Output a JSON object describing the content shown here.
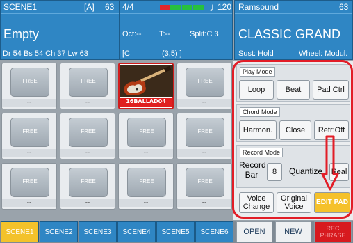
{
  "header": {
    "scene_name": "SCENE1",
    "scene_bank": "[A]",
    "scene_num": "63",
    "scene_title": "Empty",
    "mix_line": "Dr 54  Bs 54  Ch 37  Lw 63",
    "time_sig": "4/4",
    "tempo": "120",
    "oct": "Oct:--",
    "transpose": "T:--",
    "split": "Split:C 3",
    "chord_bracket": "[C",
    "chord_pos": "(3,5) ]",
    "sound_bank": "Ramsound",
    "sound_num": "63",
    "sound_name": "CLASSIC GRAND",
    "sust": "Sust: Hold",
    "wheel": "Wheel: Modul."
  },
  "pads": [
    {
      "label": "FREE",
      "name": "--"
    },
    {
      "label": "FREE",
      "name": "--"
    },
    {
      "label": "",
      "name": "16BALLAD04"
    },
    {
      "label": "FREE",
      "name": "--"
    },
    {
      "label": "FREE",
      "name": "--"
    },
    {
      "label": "FREE",
      "name": "--"
    },
    {
      "label": "FREE",
      "name": "--"
    },
    {
      "label": "FREE",
      "name": "--"
    },
    {
      "label": "FREE",
      "name": "--"
    },
    {
      "label": "FREE",
      "name": "--"
    },
    {
      "label": "FREE",
      "name": "--"
    },
    {
      "label": "FREE",
      "name": "--"
    }
  ],
  "play_mode": {
    "label": "Play Mode",
    "loop": "Loop",
    "beat": "Beat",
    "pad_ctrl": "Pad Ctrl"
  },
  "chord_mode": {
    "label": "Chord Mode",
    "harmon": "Harmon.",
    "close": "Close",
    "retr": "Retr:Off"
  },
  "record_mode": {
    "label": "Record Mode",
    "record_bar_1": "Record",
    "record_bar_2": "Bar",
    "bar_value": "8",
    "quantize": "Quantize",
    "real": "Real"
  },
  "actions": {
    "voice_change_1": "Voice",
    "voice_change_2": "Change",
    "original_voice_1": "Original",
    "original_voice_2": "Voice",
    "edit_pad": "EDIT PAD"
  },
  "scenes": [
    "SCENE1",
    "SCENE2",
    "SCENE3",
    "SCENE4",
    "SCENE5",
    "SCENE6"
  ],
  "bottom": {
    "open": "OPEN",
    "new": "NEW",
    "rec_1": "REC",
    "rec_2": "PHRASE"
  },
  "colors": {
    "header_blue": "#2f86c4",
    "highlight_red": "#e21d27",
    "edit_yellow": "#f5c12a"
  },
  "icons": {
    "tempo": "quarter-note-icon",
    "pad_image": "electric-guitar-icon",
    "annotation": "down-arrow-icon"
  }
}
